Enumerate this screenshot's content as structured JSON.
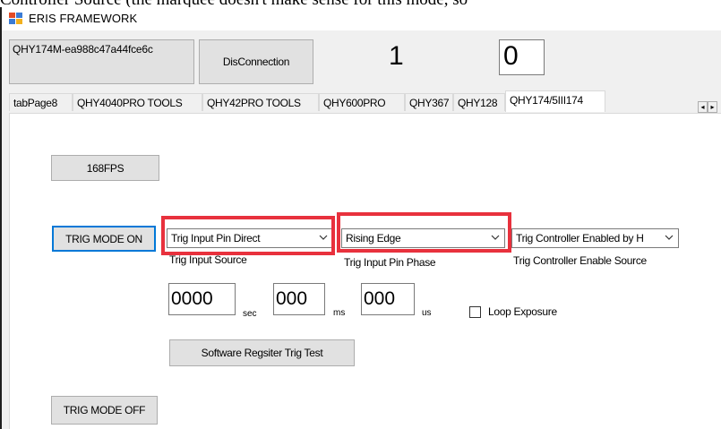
{
  "top_cut_text": "Controller Source (the marquee doesn't make sense for this mode, so",
  "window": {
    "title": "ERIS FRAMEWORK"
  },
  "header": {
    "device_id": "QHY174M-ea988c47a44fce6c",
    "disconnect_label": "DisConnection",
    "counter_label": "1",
    "counter_box_value": "0"
  },
  "tabs": [
    {
      "label": "tabPage8"
    },
    {
      "label": "QHY4040PRO TOOLS"
    },
    {
      "label": "QHY42PRO TOOLS"
    },
    {
      "label": "QHY600PRO"
    },
    {
      "label": "QHY367"
    },
    {
      "label": "QHY128"
    },
    {
      "label": "QHY174/5III174",
      "active": true
    }
  ],
  "tab_scroll": {
    "left": "◂",
    "right": "▸"
  },
  "panel": {
    "fps_button": "168FPS",
    "trig_on_button": "TRIG MODE ON",
    "trig_off_button": "TRIG MODE OFF",
    "trig_input_source": {
      "value": "Trig Input Pin Direct",
      "caption": "Trig Input Source"
    },
    "trig_input_phase": {
      "value": "Rising Edge",
      "caption": "Trig Input Pin Phase"
    },
    "trig_controller": {
      "value": "Trig Controller Enabled by H",
      "caption": "Trig Controller Enable Source"
    },
    "time_sec": {
      "value": "0000",
      "unit": "sec"
    },
    "time_ms": {
      "value": "000",
      "unit": "ms"
    },
    "time_us": {
      "value": "000",
      "unit": "us"
    },
    "loop_exposure_label": "Loop Exposure",
    "software_trig_button": "Software Regsiter Trig Test"
  },
  "colors": {
    "highlight_frame": "#e8313d",
    "focus_border": "#0078d7",
    "window_bg": "#f0f0f0",
    "button_bg": "#e1e1e1"
  }
}
